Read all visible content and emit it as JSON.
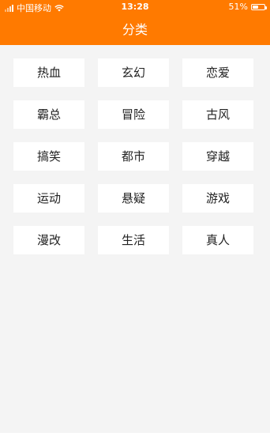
{
  "status_bar": {
    "carrier": "中国移动",
    "time": "13:28",
    "battery_percent": "51%",
    "battery_level": 0.51,
    "signal_icon": "signal-icon",
    "wifi_icon": "wifi-icon",
    "battery_icon": "battery-icon"
  },
  "header": {
    "title": "分类",
    "background_color": "#ff7a00"
  },
  "categories": [
    {
      "label": "热血"
    },
    {
      "label": "玄幻"
    },
    {
      "label": "恋爱"
    },
    {
      "label": "霸总"
    },
    {
      "label": "冒险"
    },
    {
      "label": "古风"
    },
    {
      "label": "搞笑"
    },
    {
      "label": "都市"
    },
    {
      "label": "穿越"
    },
    {
      "label": "运动"
    },
    {
      "label": "悬疑"
    },
    {
      "label": "游戏"
    },
    {
      "label": "漫改"
    },
    {
      "label": "生活"
    },
    {
      "label": "真人"
    }
  ]
}
